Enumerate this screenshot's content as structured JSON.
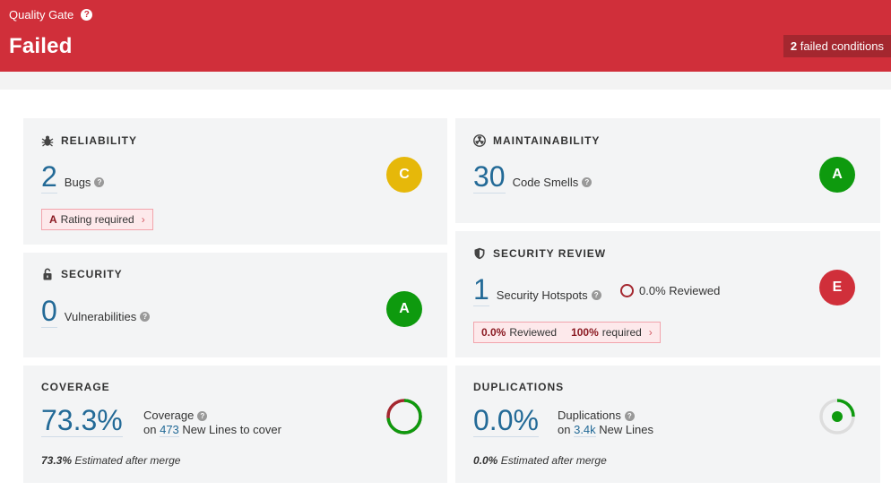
{
  "quality_gate": {
    "title": "Quality Gate",
    "status": "Failed",
    "failed_count": "2",
    "failed_text": "failed conditions"
  },
  "reliability": {
    "title": "RELIABILITY",
    "value": "2",
    "label": "Bugs",
    "rating": "C",
    "req_grade": "A",
    "req_text": "Rating required"
  },
  "security": {
    "title": "SECURITY",
    "value": "0",
    "label": "Vulnerabilities",
    "rating": "A"
  },
  "maintainability": {
    "title": "MAINTAINABILITY",
    "value": "30",
    "label": "Code Smells",
    "rating": "A"
  },
  "security_review": {
    "title": "SECURITY REVIEW",
    "value": "1",
    "label": "Security Hotspots",
    "reviewed": "0.0% Reviewed",
    "rating": "E",
    "req_current": "0.0%",
    "req_current_text": "Reviewed",
    "req_target": "100%",
    "req_target_text": "required"
  },
  "coverage": {
    "title": "COVERAGE",
    "value": "73.3%",
    "label": "Coverage",
    "on": "on",
    "lines": "473",
    "lines_text": "New Lines to cover",
    "merge_value": "73.3%",
    "merge_text": "Estimated after merge",
    "fraction": 0.733
  },
  "duplications": {
    "title": "DUPLICATIONS",
    "value": "0.0%",
    "label": "Duplications",
    "on": "on",
    "lines": "3.4k",
    "lines_text": "New Lines",
    "merge_value": "0.0%",
    "merge_text": "Estimated after merge"
  },
  "colors": {
    "header_red": "#d02f3a",
    "rating_c": "#e6b80a",
    "rating_a": "#0e9a0e",
    "rating_e": "#d02f3a",
    "link_blue": "#236a97"
  }
}
